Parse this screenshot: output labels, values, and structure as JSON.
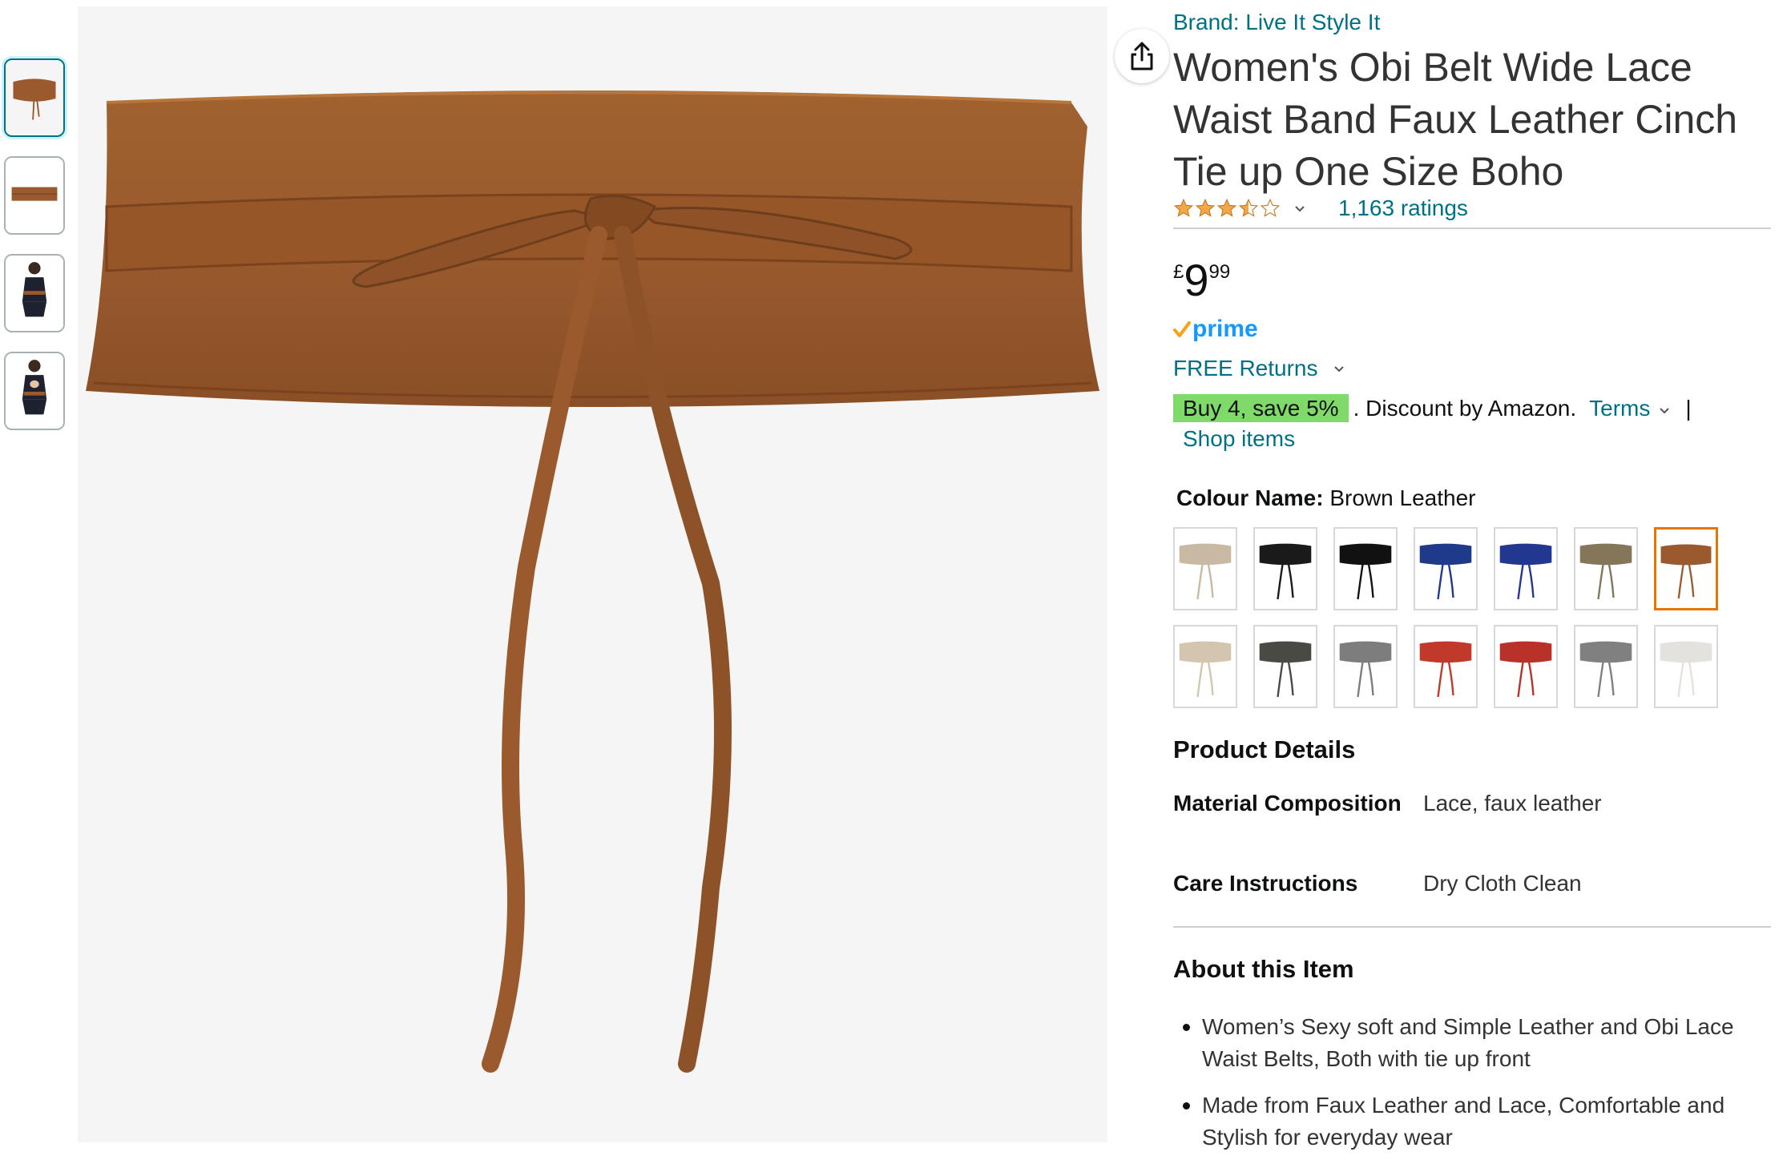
{
  "brand": "Brand: Live It Style It",
  "title": "Women's Obi Belt Wide Lace Waist Band Faux Leather Cinch Tie up One Size Boho",
  "rating": {
    "stars": 3.5,
    "count_text": "1,163 ratings"
  },
  "price": {
    "symbol": "£",
    "whole": "9",
    "fraction": "99"
  },
  "prime_label": "prime",
  "free_returns": "FREE Returns",
  "promo": {
    "badge": "Buy 4, save 5%",
    "text": ". Discount by Amazon.",
    "terms": "Terms",
    "separator": "|",
    "shop_items": "Shop items"
  },
  "colour": {
    "label": "Colour Name:",
    "value": "Brown Leather"
  },
  "swatches": [
    {
      "color": "#c9b9a2",
      "selected": false
    },
    {
      "color": "#1a1a1a",
      "selected": false
    },
    {
      "color": "#111111",
      "selected": false
    },
    {
      "color": "#1f3a8a",
      "selected": false
    },
    {
      "color": "#22378f",
      "selected": false
    },
    {
      "color": "#857559",
      "selected": false
    },
    {
      "color": "#9a5a2e",
      "selected": true
    },
    {
      "color": "#d4c6ae",
      "selected": false
    },
    {
      "color": "#4a4a44",
      "selected": false
    },
    {
      "color": "#7d7d7d",
      "selected": false
    },
    {
      "color": "#c0392b",
      "selected": false
    },
    {
      "color": "#b8322a",
      "selected": false
    },
    {
      "color": "#808080",
      "selected": false
    },
    {
      "color": "#e4e2df",
      "selected": false
    }
  ],
  "product_details": {
    "heading": "Product Details",
    "rows": [
      {
        "label": "Material Composition",
        "value": "Lace, faux leather"
      },
      {
        "label": "Care Instructions",
        "value": "Dry Cloth Clean"
      }
    ]
  },
  "about": {
    "heading": "About this Item",
    "bullets": [
      "Women’s Sexy soft and Simple Leather and Obi Lace Waist Belts, Both with tie up front",
      "Made from Faux Leather and Lace, Comfortable and Stylish for everyday wear"
    ]
  },
  "colors": {
    "link": "#007185",
    "accent_selected": "#e77600",
    "promo_green": "#7fda69",
    "belt_brown": "#9a5a2e"
  }
}
